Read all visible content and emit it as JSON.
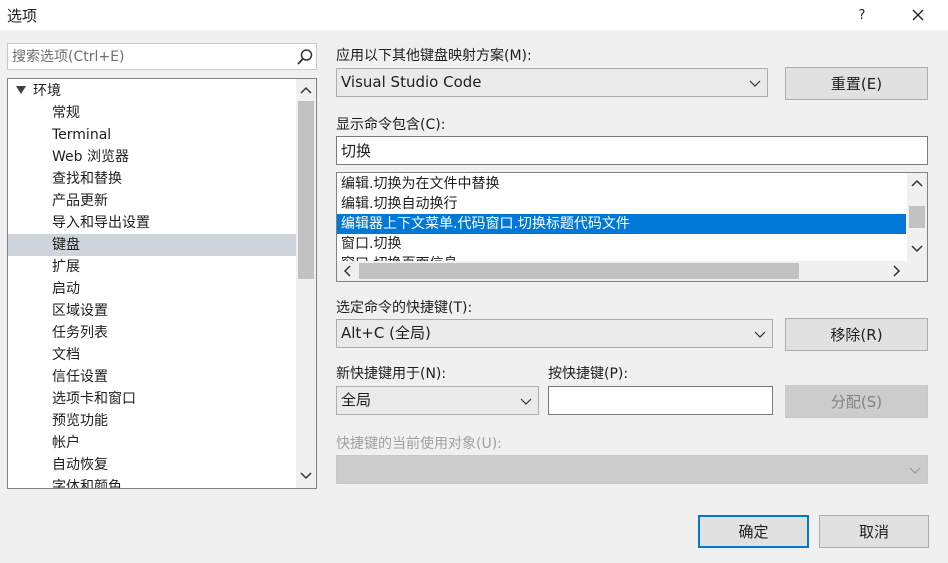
{
  "window": {
    "title": "选项",
    "help_glyph": "?",
    "close_icon": "close-icon"
  },
  "search": {
    "placeholder": "搜索选项(Ctrl+E)",
    "icon": "search-icon"
  },
  "tree": {
    "root_label": "环境",
    "items": [
      "常规",
      "Terminal",
      "Web 浏览器",
      "查找和替换",
      "产品更新",
      "导入和导出设置",
      "键盘",
      "扩展",
      "启动",
      "区域设置",
      "任务列表",
      "文档",
      "信任设置",
      "选项卡和窗口",
      "预览功能",
      "帐户",
      "自动恢复",
      "字体和颜色"
    ],
    "selected": "键盘"
  },
  "keymap": {
    "label": "应用以下其他键盘映射方案(M):",
    "value": "Visual Studio Code",
    "reset_label": "重置(E)"
  },
  "show_commands": {
    "label": "显示命令包含(C):",
    "value": "切换"
  },
  "commands": {
    "items": [
      "编辑.切换为在文件中替换",
      "编辑.切换自动换行",
      "编辑器上下文菜单.代码窗口.切换标题代码文件",
      "窗口.切换",
      "窗口.切换页面信息"
    ],
    "selected_index": 2
  },
  "shortcuts_for_command": {
    "label": "选定命令的快捷键(T):",
    "value": "Alt+C (全局)",
    "remove_label": "移除(R)"
  },
  "new_shortcut_in": {
    "label": "新快捷键用于(N):",
    "value": "全局"
  },
  "press_shortcut": {
    "label": "按快捷键(P):",
    "value": ""
  },
  "assign_label": "分配(S)",
  "currently_used_by": {
    "label": "快捷键的当前使用对象(U):",
    "value": ""
  },
  "footer": {
    "ok_label": "确定",
    "cancel_label": "取消"
  },
  "colors": {
    "selection": "#0078d7",
    "tree_selection": "#cfd3dc",
    "dialog_bg": "#f0f0f0"
  }
}
